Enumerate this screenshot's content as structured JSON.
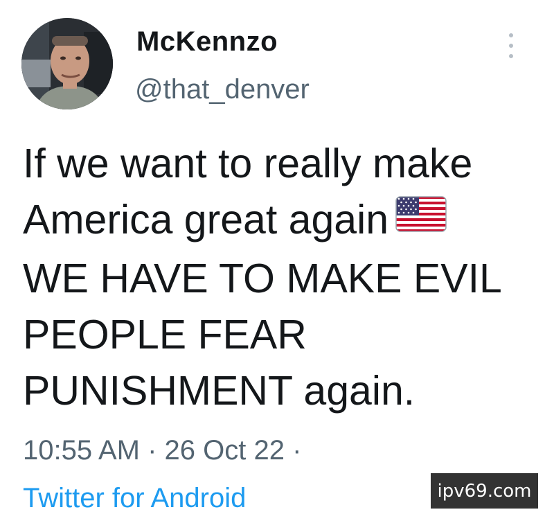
{
  "tweet": {
    "display_name": "McKennzo",
    "handle": "@that_denver",
    "text_lines": [
      "If we want to really make",
      "America great again",
      "WE HAVE TO MAKE EVIL",
      "PEOPLE FEAR",
      "PUNISHMENT again."
    ],
    "inline_emoji": "us-flag-icon",
    "timestamp": "10:55 AM · 26 Oct 22 ·",
    "source": "Twitter for Android"
  },
  "watermark": "ipv69.com",
  "colors": {
    "text": "#14171a",
    "secondary_text": "#536471",
    "link": "#1d9bf0",
    "watermark_bg": "#333333"
  }
}
